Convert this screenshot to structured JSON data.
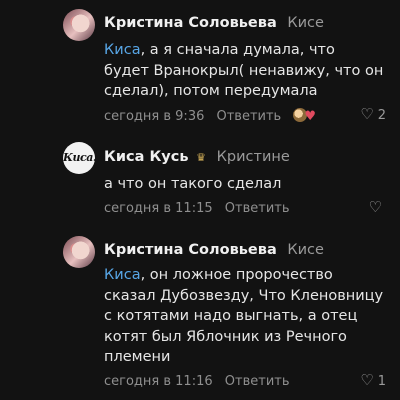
{
  "comments": [
    {
      "author": "Кристина Соловьева",
      "reply_to": "Кисе",
      "mention": "Киса",
      "text": ", а я сначала думала, что будет Вранокрыл( ненавижу, что он сделал), потом передумала",
      "time": "сегодня в 9:36",
      "reply_label": "Ответить",
      "like_icon": "heart-outline",
      "like_count": "2",
      "author_reaction": "sticker-with-heart"
    },
    {
      "author": "Киса Кусь",
      "badge_icon": "crown-icon",
      "reply_to": "Кристине",
      "avatar_text": "Киса.",
      "text": "а что он такого сделал",
      "time": "сегодня в 11:15",
      "reply_label": "Ответить",
      "like_icon": "heart-outline",
      "like_count": ""
    },
    {
      "author": "Кристина Соловьева",
      "reply_to": "Кисе",
      "mention": "Киса",
      "text": ", он ложное пророчество сказал Дубозвезду,  Что Кленовницу с котятами надо выгнать, а отец котят был Яблочник из Речного племени",
      "time": "сегодня в 11:16",
      "reply_label": "Ответить",
      "like_icon": "heart-outline",
      "like_count": "1"
    }
  ],
  "colors": {
    "background": "#121212",
    "mention": "#58a6e6",
    "meta": "#8f8f8f"
  }
}
